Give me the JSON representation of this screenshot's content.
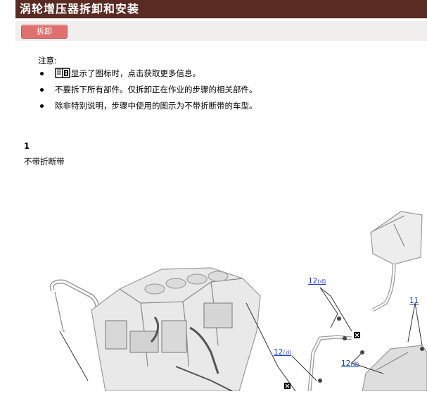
{
  "page": {
    "title": "涡轮增压器拆卸和安装",
    "section_button": "拆卸"
  },
  "notes": {
    "label": "注意:",
    "items": [
      {
        "icon": "book-icon",
        "text": "显示了图标时，点击获取更多信息。"
      },
      {
        "text": "不要拆下所有部件。仅拆卸正在作业的步骤的相关部件。"
      },
      {
        "text": "除非特别说明，步骤中使用的图示为不带折断带的车型。"
      }
    ]
  },
  "step": {
    "number": "1",
    "subtitle": "不带折断带"
  },
  "diagram": {
    "callouts": [
      {
        "text": "12",
        "suffix": "(𝕕)"
      },
      {
        "text": "12",
        "suffix": "(𝕕)"
      },
      {
        "text": "12",
        "suffix": "(𝕕)"
      },
      {
        "text": "11"
      }
    ]
  }
}
